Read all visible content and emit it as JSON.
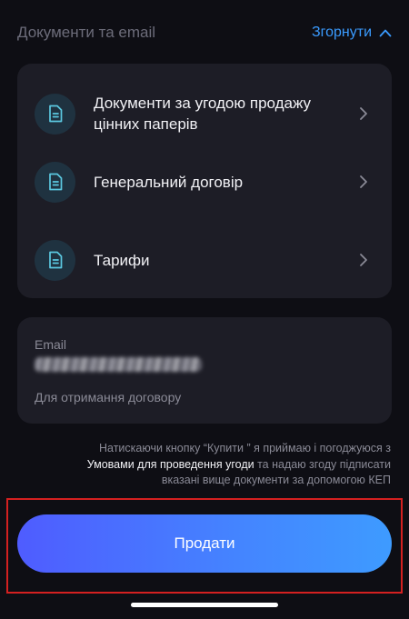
{
  "section": {
    "title": "Документи та email",
    "collapse_label": "Згорнути"
  },
  "documents": [
    {
      "label": "Документи за угодою продажу цінних паперів",
      "icon": "document-icon"
    },
    {
      "label": "Генеральний договір",
      "icon": "document-icon"
    },
    {
      "label": "Тарифи",
      "icon": "document-icon"
    }
  ],
  "email": {
    "label": "Email",
    "value_state": "redacted",
    "hint": "Для отримання договору"
  },
  "consent": {
    "line1": "Натискаючи кнопку “Купити ” я приймаю і погоджуюся з",
    "link": "Умовами для проведення угоди",
    "line2": " та надаю згоду підписати",
    "line3": "вказані вище документи за допомогою КЕП"
  },
  "action": {
    "sell_label": "Продати"
  },
  "colors": {
    "background": "#0e0e14",
    "card": "#1d1d26",
    "accent_link": "#3a9bff",
    "button_gradient_start": "#4f5cff",
    "button_gradient_end": "#3e9bff",
    "highlight_frame": "#d42020"
  }
}
